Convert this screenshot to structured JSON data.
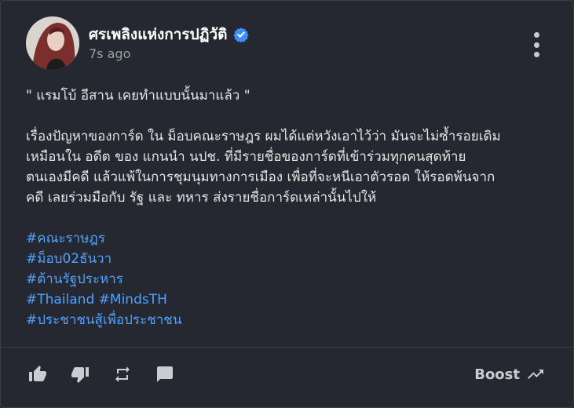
{
  "post": {
    "owner_name": "ศรเพลิงแห่งการปฏิวัติ",
    "time_ago": "7s ago",
    "quote": "\" แรมโบ้ อีสาน เคยทำแบบนั้นมาแล้ว \"",
    "paragraph_lines": [
      "เรื่องปัญหาของการ์ด ใน ม็อบคณะราษฎร ผมได้แต่หวังเอาไว้ว่า มันจะไม่ซ้ำรอยเดิม",
      "เหมือนใน อดีต ของ แกนนำ นปช. ที่มีรายชื่อของการ์ดที่เข้าร่วมทุกคนสุดท้าย",
      "ตนเองมีคดี แล้วแพ้ในการชุมนุมทางการเมือง เพื่อที่จะหนีเอาตัวรอด ให้รอดพ้นจาก",
      "คดี เลยร่วมมือกับ รัฐ และ ทหาร ส่งรายชื่อการ์ดเหล่านั้นไปให้"
    ],
    "hashtags": {
      "tag1": "#คณะราษฎร",
      "tag2": "#ม็อบ02ธันวา",
      "tag3": "#ต้านรัฐประหาร",
      "tag4": "#Thailand",
      "tag5": "#MindsTH",
      "tag6": "#ประชาชนสู้เพื่อประชาชน"
    }
  },
  "actions": {
    "boost_label": "Boost"
  },
  "icons": {
    "verified": "verified-badge-icon",
    "menu": "more-vertical-icon",
    "up": "thumb-up-icon",
    "down": "thumb-down-icon",
    "remind": "repeat-icon",
    "comment": "comment-icon",
    "boost": "trending-up-icon"
  },
  "colors": {
    "background": "#252830",
    "text": "#e6e6e6",
    "hashtag": "#4fa2ff",
    "verified": "#3d8ef7",
    "muted": "#9aa0a6"
  }
}
